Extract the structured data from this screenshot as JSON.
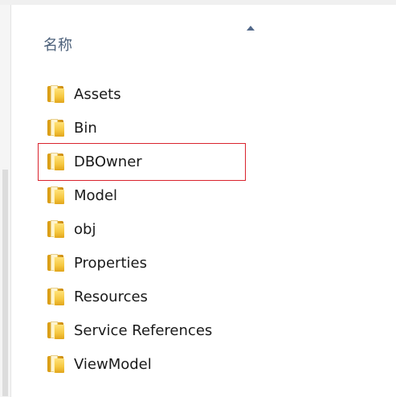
{
  "header": {
    "name_column": "名称"
  },
  "items": [
    {
      "label": "Assets",
      "icon": "folder-icon"
    },
    {
      "label": "Bin",
      "icon": "folder-icon"
    },
    {
      "label": "DBOwner",
      "icon": "folder-icon"
    },
    {
      "label": "Model",
      "icon": "folder-icon"
    },
    {
      "label": "obj",
      "icon": "folder-icon"
    },
    {
      "label": "Properties",
      "icon": "folder-icon"
    },
    {
      "label": "Resources",
      "icon": "folder-icon"
    },
    {
      "label": "Service References",
      "icon": "folder-icon"
    },
    {
      "label": "ViewModel",
      "icon": "folder-icon"
    }
  ],
  "colors": {
    "folder": "#f5c63e",
    "highlight": "#d9232d",
    "header_text": "#4c607a"
  }
}
